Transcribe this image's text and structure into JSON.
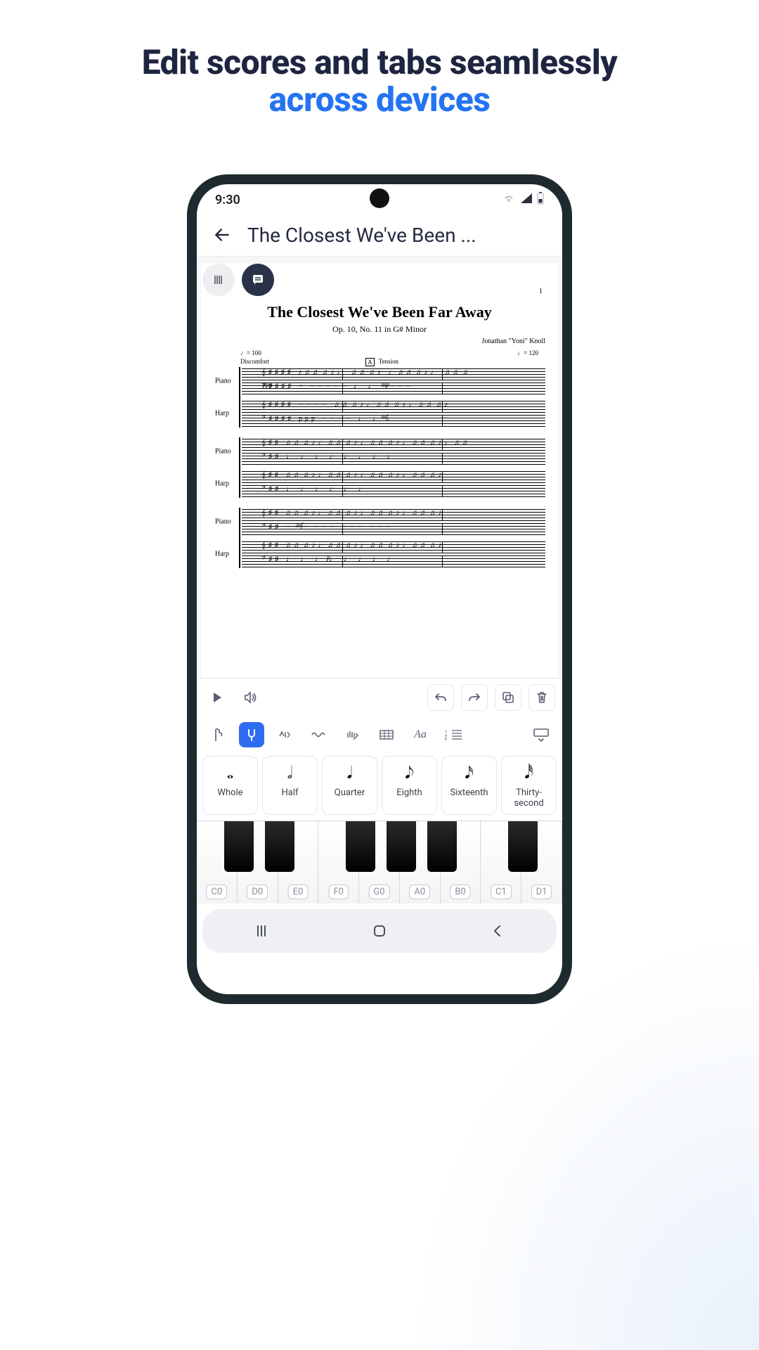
{
  "hero": {
    "line1": "Edit scores and tabs seamlessly",
    "line2": "across devices"
  },
  "status": {
    "time": "9:30"
  },
  "header": {
    "title": "The Closest We've Been ..."
  },
  "score": {
    "page": "1",
    "title": "The Closest We've Been Far Away",
    "subtitle": "Op. 10, No. 11 in G# Minor",
    "composer": "Jonathan \"Yoni\" Knoll",
    "tempo_left": "♩= 100",
    "tempo_right": "♩= 120",
    "rehearsal": "A",
    "mark_left": "Discomfort",
    "mark_right": "Tension",
    "instruments": {
      "piano": "Piano",
      "harp": "Harp"
    },
    "dynamics": {
      "ppp": "ppp",
      "mp": "mp",
      "mf": "mf",
      "p": "p"
    }
  },
  "durations": [
    {
      "glyph": "𝅝",
      "label": "Whole"
    },
    {
      "glyph": "𝅗𝅥",
      "label": "Half"
    },
    {
      "glyph": "𝅘𝅥",
      "label": "Quarter"
    },
    {
      "glyph": "𝅘𝅥𝅮",
      "label": "Eighth"
    },
    {
      "glyph": "𝅘𝅥𝅯",
      "label": "Sixteenth"
    },
    {
      "glyph": "𝅘𝅥𝅰",
      "label": "Thirty-second"
    }
  ],
  "tool_tabs": {
    "text_glyph": "Aa",
    "tab_glyph": "TAB"
  },
  "piano": {
    "white_labels": [
      "C0",
      "D0",
      "E0",
      "F0",
      "G0",
      "A0",
      "B0",
      "C1",
      "D1"
    ]
  }
}
